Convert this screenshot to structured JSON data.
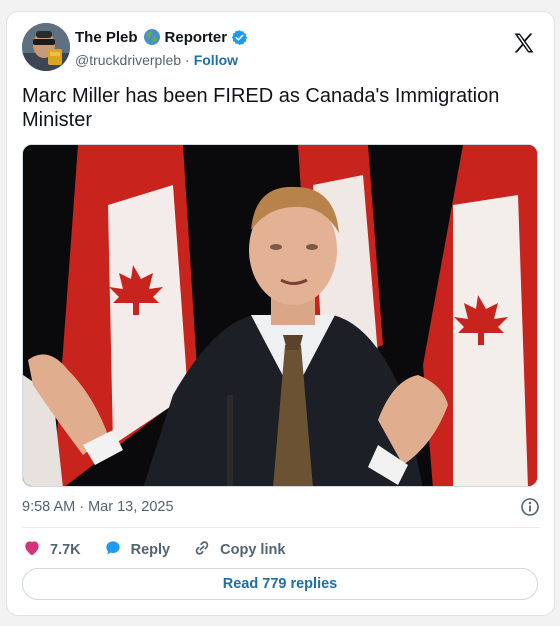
{
  "author": {
    "name_part1": "The Pleb",
    "name_part2": "Reporter",
    "handle": "@truckdriverpleb",
    "separator": "·",
    "follow_label": "Follow"
  },
  "tweet": {
    "text": "Marc Miller has been FIRED as Canada's Immigration Minister",
    "timestamp": "9:58 AM · Mar 13, 2025"
  },
  "actions": {
    "like_count": "7.7K",
    "reply_label": "Reply",
    "copy_link_label": "Copy link"
  },
  "footer": {
    "read_replies_label": "Read 779 replies"
  },
  "colors": {
    "like": "#d6347a",
    "reply": "#1d9bf0",
    "link": "#1d6fa5",
    "verified": "#1d9bf0",
    "flag_red": "#d52b1e"
  },
  "icons": [
    "globe-icon",
    "verified-badge-icon",
    "x-logo-icon",
    "info-icon",
    "heart-icon",
    "reply-bubble-icon",
    "link-icon"
  ]
}
